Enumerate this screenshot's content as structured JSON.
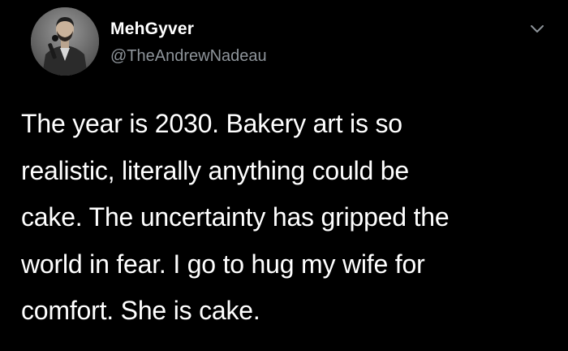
{
  "tweet": {
    "display_name": "MehGyver",
    "handle": "@TheAndrewNadeau",
    "text": "The year is 2030. Bakery art is so\nrealistic, literally anything could be\ncake. The uncertainty has gripped the\nworld in fear. I go to hug my wife for\ncomfort. She is cake.",
    "avatar_icon": "user-avatar-photo",
    "more_icon": "chevron-down-icon"
  },
  "colors": {
    "background": "#000000",
    "text_primary": "#ffffff",
    "text_secondary": "#8e949a"
  }
}
